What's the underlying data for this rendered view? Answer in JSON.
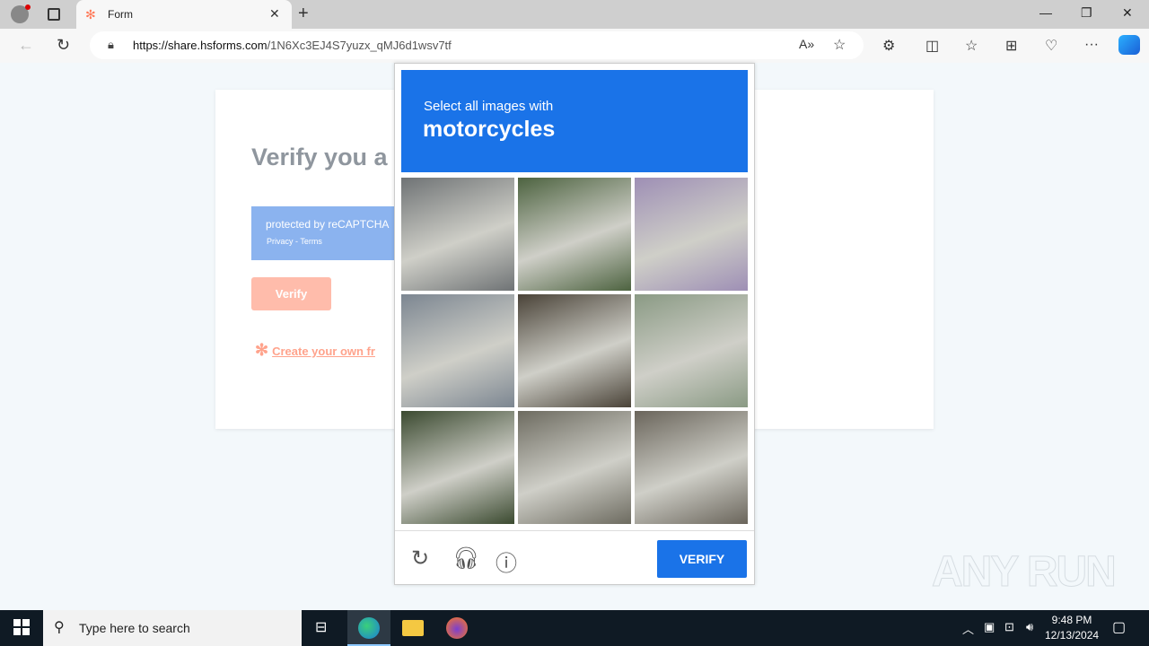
{
  "browser": {
    "tab_title": "Form",
    "tab_icon": "hubspot-icon",
    "url_host": "https://share.hsforms.com",
    "url_path": "/1N6Xc3EJ4S7yuzx_qMJ6d1wsv7tf"
  },
  "form": {
    "heading": "Verify you a",
    "recaptcha_protected": "protected by reCAPTCHA",
    "recaptcha_links": "Privacy - Terms",
    "verify_label": "Verify",
    "create_link": "Create your own fr"
  },
  "captcha": {
    "instruction": "Select all images with",
    "target": "motorcycles",
    "verify_label": "VERIFY",
    "tiles": [
      {
        "desc": "street road markings",
        "color": "#6f7375"
      },
      {
        "desc": "tuk-tuk with motorcycle",
        "color": "#4d6340"
      },
      {
        "desc": "building with banner",
        "color": "#9e8fb5"
      },
      {
        "desc": "rider on motorcycle",
        "color": "#7c8691"
      },
      {
        "desc": "parked scooters",
        "color": "#4a4338"
      },
      {
        "desc": "street with scooters",
        "color": "#8a9a84"
      },
      {
        "desc": "tree and house",
        "color": "#3b4a30"
      },
      {
        "desc": "fence and gate",
        "color": "#6d6b60"
      },
      {
        "desc": "yard with motorbike",
        "color": "#6a655b"
      }
    ]
  },
  "watermark": "ANY RUN",
  "taskbar": {
    "search_placeholder": "Type here to search",
    "time": "9:48 PM",
    "date": "12/13/2024"
  }
}
